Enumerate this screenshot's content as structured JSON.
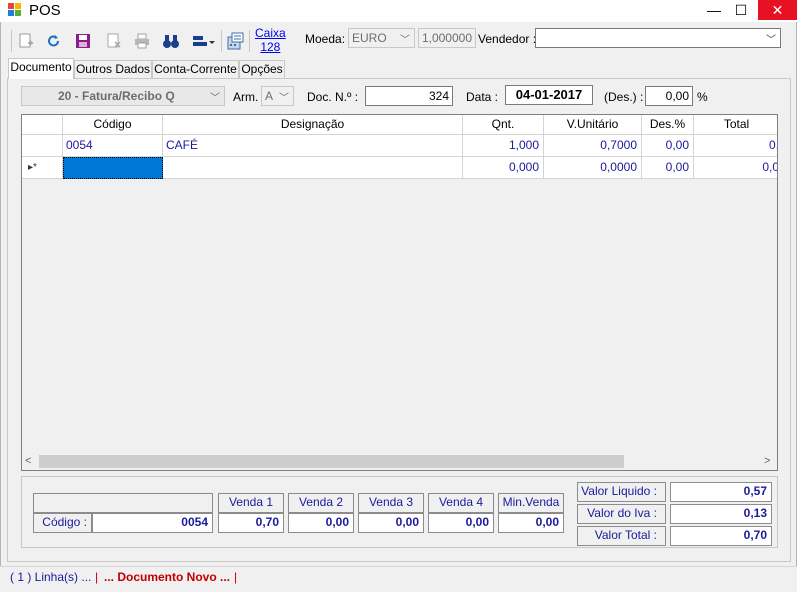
{
  "window": {
    "title": "POS",
    "minimize": "—",
    "maximize": "☐",
    "close": "✕"
  },
  "toolbar": {
    "caixa_label": "Caixa",
    "caixa_number": "128",
    "moeda_label": "Moeda:",
    "moeda_value": "EURO",
    "rate_value": "1,000000",
    "vendedor_label": "Vendedor :",
    "vendedor_value": ""
  },
  "tabs": [
    {
      "label": "Documento"
    },
    {
      "label": "Outros Dados"
    },
    {
      "label": "Conta-Corrente"
    },
    {
      "label": "Opções"
    }
  ],
  "document": {
    "type_value": "20 - Fatura/Recibo Q",
    "arm_label": "Arm. :",
    "arm_value": "A",
    "doc_label": "Doc. N.º :",
    "doc_value": "324",
    "data_label": "Data :",
    "data_value": "04-01-2017",
    "des_label": "(Des.) :",
    "des_value": "0,00",
    "pct_label": "%"
  },
  "grid": {
    "headers": {
      "codigo": "Código",
      "designacao": "Designação",
      "qnt": "Qnt.",
      "vunit": "V.Unitário",
      "des": "Des.%",
      "total": "Total"
    },
    "rows": [
      {
        "codigo": "0054",
        "designacao": "CAFÉ",
        "qnt": "1,000",
        "vunit": "0,7000",
        "des": "0,00",
        "total": "0,"
      },
      {
        "marker": "▸*",
        "codigo": "",
        "designacao": "",
        "qnt": "0,000",
        "vunit": "0,0000",
        "des": "0,00",
        "total": "0,0"
      }
    ]
  },
  "summary": {
    "codigo_label": "Código :",
    "codigo_value": "0054",
    "venda_headers": [
      "Venda 1",
      "Venda 2",
      "Venda 3",
      "Venda 4",
      "Min.Venda"
    ],
    "venda_values": [
      "0,70",
      "0,00",
      "0,00",
      "0,00",
      "0,00"
    ],
    "valor_liquido_label": "Valor Liquido :",
    "valor_liquido": "0,57",
    "valor_iva_label": "Valor do Iva :",
    "valor_iva": "0,13",
    "valor_total_label": "Valor Total :",
    "valor_total": "0,70"
  },
  "status": {
    "lines": "( 1 ) Linha(s) ...",
    "sep1": "|",
    "doc_state": "... Documento Novo ...",
    "sep2": "|"
  },
  "colors": {
    "accent_blue": "#1a1a9c",
    "status_red": "#c00000",
    "selection": "#0078d7",
    "close_red": "#e81123"
  }
}
